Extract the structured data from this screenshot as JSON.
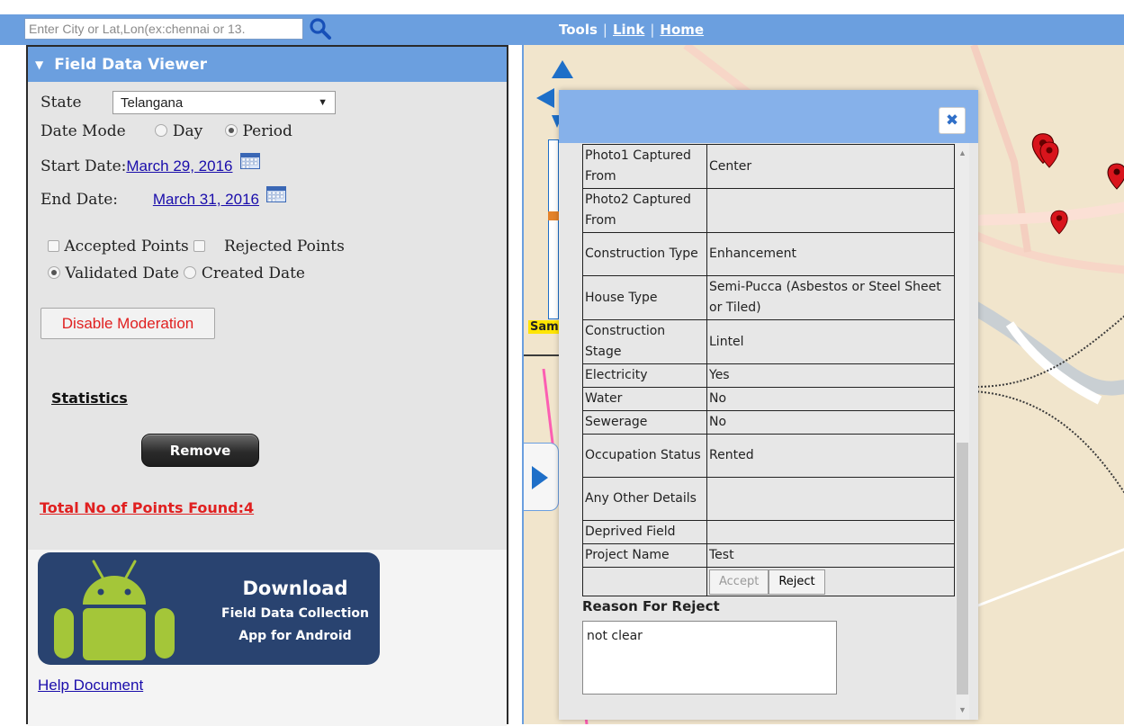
{
  "search": {
    "placeholder": "Enter City or Lat,Lon(ex:chennai or 13."
  },
  "toolbar": {
    "tools": "Tools",
    "link": "Link",
    "home": "Home",
    "separator": "|"
  },
  "panel": {
    "title": "Field Data Viewer",
    "state_label": "State",
    "state_value": "Telangana",
    "date_mode_label": "Date Mode",
    "date_mode_options": [
      "Day",
      "Period"
    ],
    "date_mode_selected": "Period",
    "start_date_label": "Start Date:",
    "start_date_value": "March 29, 2016",
    "end_date_label": "End Date:",
    "end_date_value": "March 31, 2016",
    "accepted_points": "Accepted Points",
    "rejected_points": "Rejected Points",
    "validated_date": "Validated Date",
    "created_date": "Created Date",
    "date_filter_selected": "Validated Date",
    "disable_moderation": "Disable Moderation",
    "statistics": "Statistics",
    "remove": "Remove",
    "total_points": "Total No of Points Found:4",
    "banner": {
      "line1": "Download",
      "line2": "Field Data Collection",
      "line3": "App for Android"
    },
    "help_document": "Help Document"
  },
  "map": {
    "place_label": "Sam"
  },
  "popup": {
    "close": "✖",
    "rows": [
      {
        "key": "Photo1 Captured From",
        "value": "Center"
      },
      {
        "key": "Photo2 Captured From",
        "value": ""
      },
      {
        "key": "Construction Type",
        "value": "Enhancement"
      },
      {
        "key": "House Type",
        "value": "Semi-Pucca (Asbestos or Steel Sheet or Tiled)"
      },
      {
        "key": "Construction Stage",
        "value": "Lintel"
      },
      {
        "key": "Electricity",
        "value": "Yes"
      },
      {
        "key": "Water",
        "value": "No"
      },
      {
        "key": "Sewerage",
        "value": "No"
      },
      {
        "key": "Occupation Status",
        "value": "Rented"
      },
      {
        "key": "Any Other Details",
        "value": ""
      },
      {
        "key": "Deprived Field",
        "value": ""
      },
      {
        "key": "Project Name",
        "value": "Test"
      }
    ],
    "accept": "Accept",
    "reject": "Reject",
    "reason_label": "Reason For Reject",
    "reason_value": "not clear"
  },
  "colors": {
    "header_blue": "#6b9fdf",
    "popup_header": "#86b1ea",
    "alert_red": "#e02020",
    "link_blue": "#1a0dab",
    "map_base": "#f1e5cc"
  },
  "icons": [
    "search-icon",
    "calendar-icon",
    "collapse-triangle-icon",
    "close-icon",
    "android-icon",
    "map-pin-icon",
    "pan-arrow-icon",
    "expand-arrow-icon"
  ]
}
